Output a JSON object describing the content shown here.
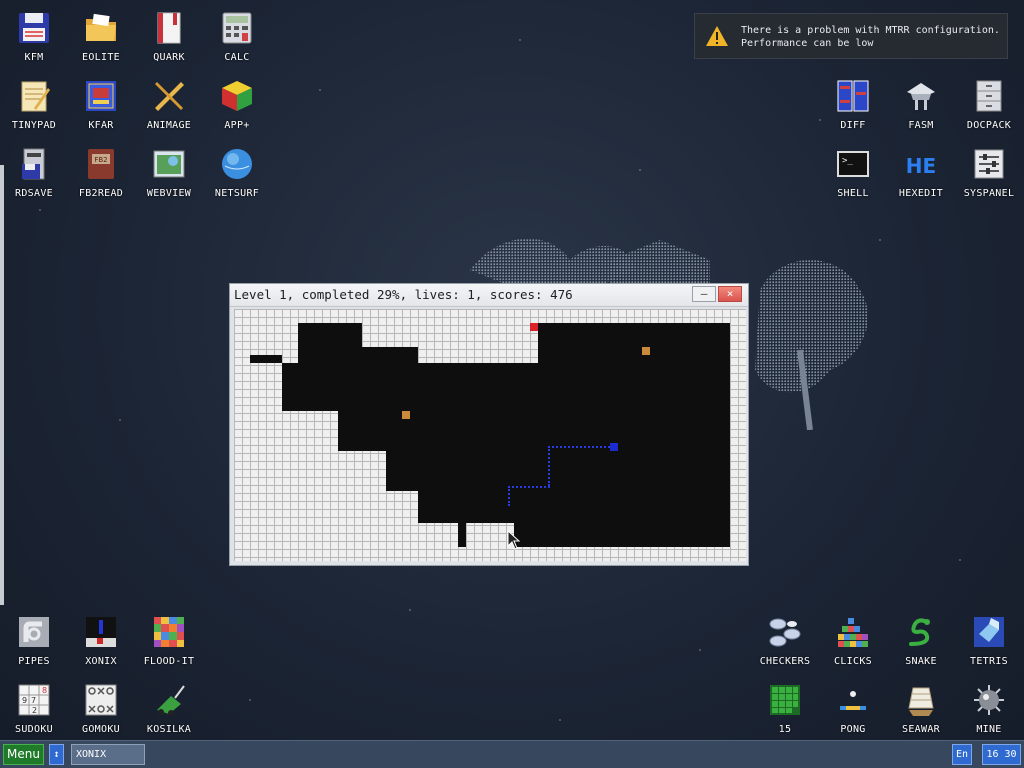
{
  "desktop": {
    "icons_top_left": [
      {
        "label": "KFM",
        "icon": "floppy-disk-icon"
      },
      {
        "label": "EOLITE",
        "icon": "folder-icon"
      },
      {
        "label": "QUARK",
        "icon": "book-icon"
      },
      {
        "label": "CALC",
        "icon": "calculator-icon"
      },
      {
        "label": "TINYPAD",
        "icon": "notepad-icon"
      },
      {
        "label": "KFAR",
        "icon": "archive-icon"
      },
      {
        "label": "ANIMAGE",
        "icon": "ruler-pencil-icon"
      },
      {
        "label": "APP+",
        "icon": "rubik-cube-icon"
      },
      {
        "label": "RDSAVE",
        "icon": "ramdisk-icon"
      },
      {
        "label": "FB2READ",
        "icon": "fb2-book-icon"
      },
      {
        "label": "WEBVIEW",
        "icon": "webview-icon"
      },
      {
        "label": "NETSURF",
        "icon": "globe-icon"
      }
    ],
    "icons_top_right": [
      {
        "label": "DIFF",
        "icon": "diff-icon"
      },
      {
        "label": "FASM",
        "icon": "fasm-icon"
      },
      {
        "label": "DOCPACK",
        "icon": "cabinet-icon"
      },
      {
        "label": "SHELL",
        "icon": "terminal-icon"
      },
      {
        "label": "HEXEDIT",
        "icon": "hex-icon"
      },
      {
        "label": "SYSPANEL",
        "icon": "sliders-icon"
      }
    ],
    "icons_bottom_left": [
      {
        "label": "PIPES",
        "icon": "pipes-icon"
      },
      {
        "label": "XONIX",
        "icon": "xonix-icon"
      },
      {
        "label": "FLOOD-IT",
        "icon": "flood-it-icon"
      },
      {
        "label": "SUDOKU",
        "icon": "sudoku-icon"
      },
      {
        "label": "GOMOKU",
        "icon": "gomoku-icon"
      },
      {
        "label": "KOSILKA",
        "icon": "lawnmower-icon"
      }
    ],
    "icons_bottom_right": [
      {
        "label": "CHECKERS",
        "icon": "checkers-icon"
      },
      {
        "label": "CLICKS",
        "icon": "clicks-icon"
      },
      {
        "label": "SNAKE",
        "icon": "snake-icon"
      },
      {
        "label": "TETRIS",
        "icon": "tetris-icon"
      },
      {
        "label": "15",
        "icon": "fifteen-puzzle-icon"
      },
      {
        "label": "PONG",
        "icon": "pong-icon"
      },
      {
        "label": "SEAWAR",
        "icon": "seawar-icon"
      },
      {
        "label": "MINE",
        "icon": "mine-icon"
      }
    ]
  },
  "notification": {
    "line1": "There is a problem with MTRR configuration.",
    "line2": "Performance can be low",
    "icon": "warning-icon"
  },
  "game_window": {
    "title": "Level 1, completed 29%, lives: 1, scores: 476",
    "minimize_label": "–",
    "close_label": "×"
  },
  "taskbar": {
    "menu_label": "Menu",
    "switch_label": "↕",
    "task_label": "XONIX",
    "lang_label": "En",
    "clock": "16 30"
  },
  "colors": {
    "desktop_bg": "#1c2535",
    "taskbar_bg": "#37475e",
    "menu_green": "#1f7a29",
    "accent_blue": "#2f6ad0",
    "player_red": "#d9232a",
    "enemy_orange": "#c98a3a",
    "trail_blue": "#1a2bd0"
  }
}
